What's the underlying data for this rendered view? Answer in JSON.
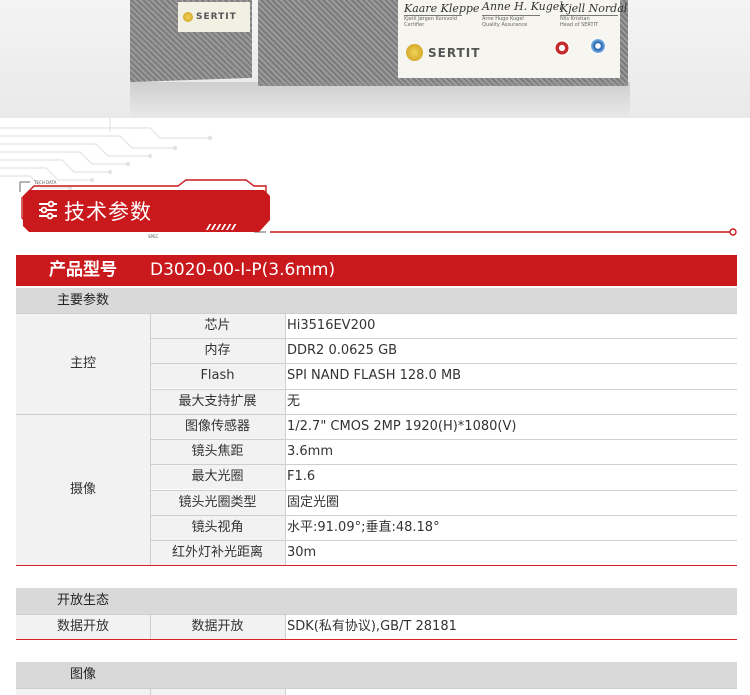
{
  "banner": {
    "left_logo": "SERTIT",
    "right_logo": "SERTIT",
    "signatures": [
      "Kaare Kleppe",
      "Anne H. Kugel",
      "Kjell Nordal"
    ],
    "sig_names": [
      "Kjetil Jørgen Korsvold",
      "Arne Hugo Kugel",
      "Nils Kristian"
    ],
    "sig_roles": [
      "Certifier",
      "Quality Assurance",
      "Head of SERTIT"
    ]
  },
  "section": {
    "title": "技术参数",
    "icon": "sliders-icon"
  },
  "table": {
    "product_label": "产品型号",
    "product_value": "D3020-00-I-P(3.6mm)",
    "groups": [
      {
        "header": "主要参数",
        "blocks": [
          {
            "name": "主控",
            "rows": [
              {
                "key": "芯片",
                "value": "Hi3516EV200"
              },
              {
                "key": "内存",
                "value": "DDR2 0.0625 GB"
              },
              {
                "key": "Flash",
                "value": "SPI NAND FLASH 128.0 MB"
              },
              {
                "key": "最大支持扩展",
                "value": "无"
              }
            ]
          },
          {
            "name": "摄像",
            "rows": [
              {
                "key": "图像传感器",
                "value": "1/2.7\" CMOS 2MP 1920(H)*1080(V)"
              },
              {
                "key": "镜头焦距",
                "value": "3.6mm"
              },
              {
                "key": "最大光圈",
                "value": "F1.6"
              },
              {
                "key": "镜头光圈类型",
                "value": "固定光圈"
              },
              {
                "key": "镜头视角",
                "value": "水平:91.09°;垂直:48.18°"
              },
              {
                "key": "红外灯补光距离",
                "value": "30m"
              }
            ]
          }
        ]
      },
      {
        "header": "开放生态",
        "blocks": [
          {
            "name": "数据开放",
            "rows": [
              {
                "key": "数据开放",
                "value": "SDK(私有协议),GB/T 28181"
              }
            ]
          }
        ]
      },
      {
        "header": "图像",
        "blocks": []
      }
    ]
  },
  "colors": {
    "accent": "#c9191c",
    "header_gray": "#d9d9d9",
    "cell_gray": "#f2f2f2"
  }
}
